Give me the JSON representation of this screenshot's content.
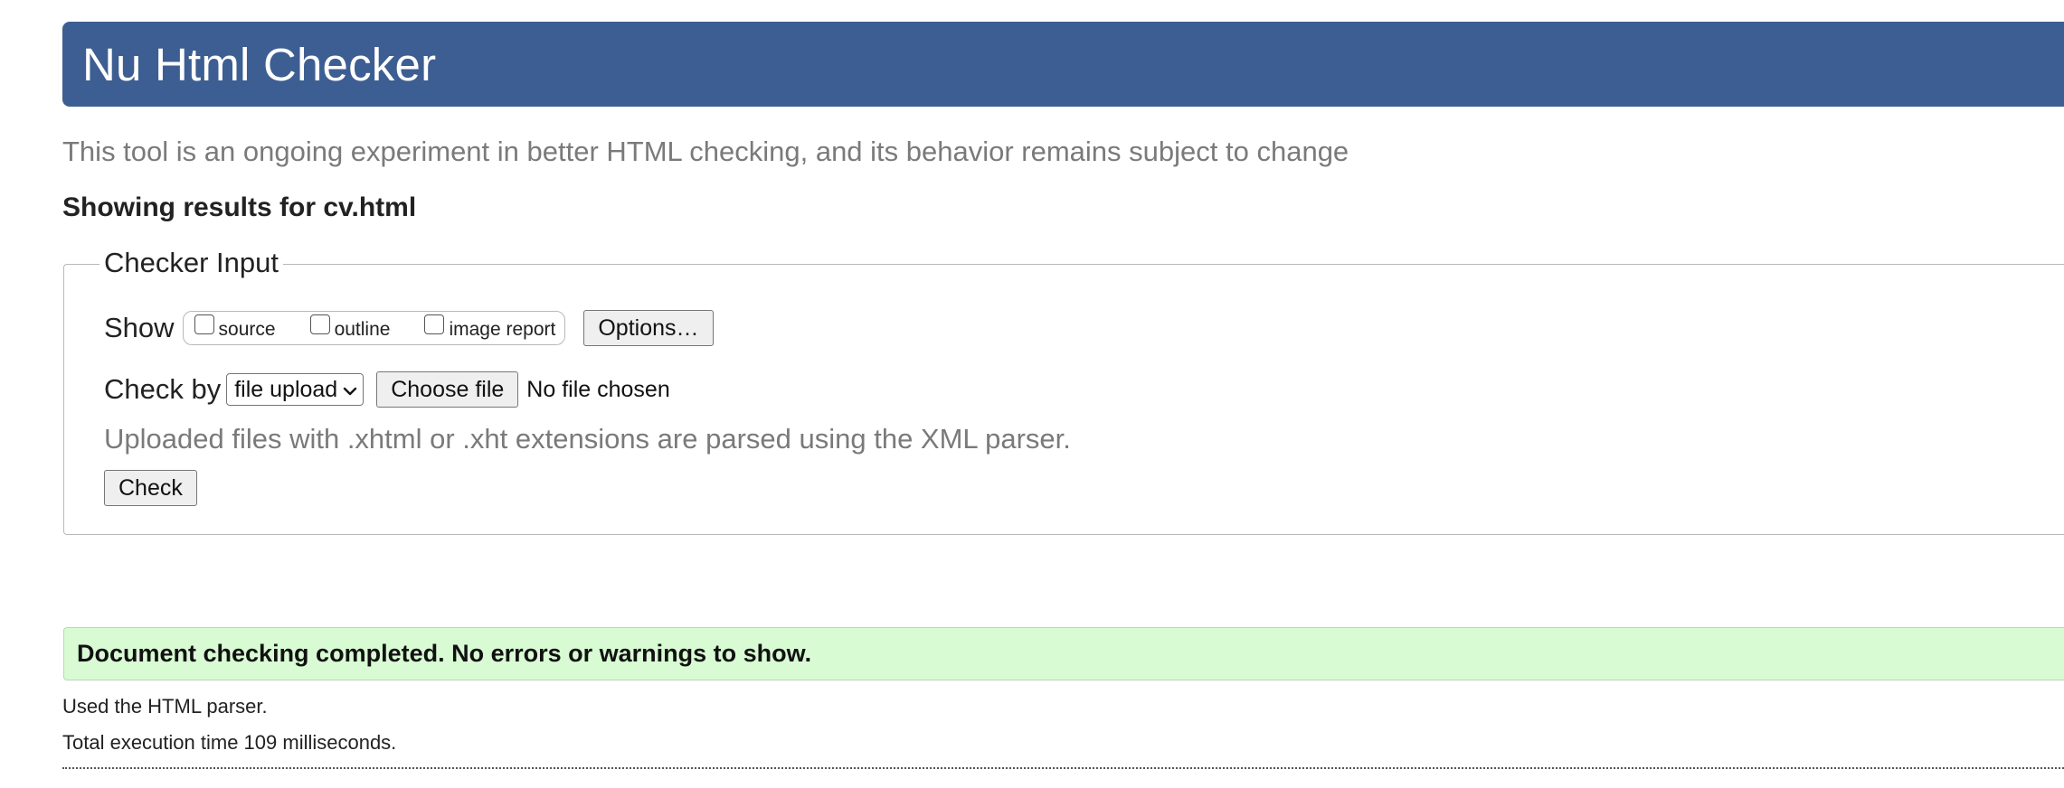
{
  "header": {
    "title": "Nu Html Checker"
  },
  "subtitle": "This tool is an ongoing experiment in better HTML checking, and its behavior remains subject to change",
  "results": {
    "prefix": "Showing results for",
    "filename": "cv.html"
  },
  "checker_input": {
    "legend": "Checker Input",
    "show_label": "Show",
    "checkboxes": [
      {
        "label": "source",
        "checked": false
      },
      {
        "label": "outline",
        "checked": false
      },
      {
        "label": "image report",
        "checked": false
      }
    ],
    "options_button": "Options…",
    "check_by_label": "Check by",
    "check_by_selected": "file upload",
    "choose_file_button": "Choose file",
    "no_file_text": "No file chosen",
    "upload_note": "Uploaded files with .xhtml or .xht extensions are parsed using the XML parser.",
    "check_button": "Check"
  },
  "status": {
    "message": "Document checking completed. No errors or warnings to show.",
    "parser_line": "Used the HTML parser.",
    "time_line": "Total execution time 109 milliseconds.",
    "success_color": "#d8fbd3"
  },
  "colors": {
    "header_bg": "#3d5e92",
    "muted_text": "#7a7a7a"
  }
}
